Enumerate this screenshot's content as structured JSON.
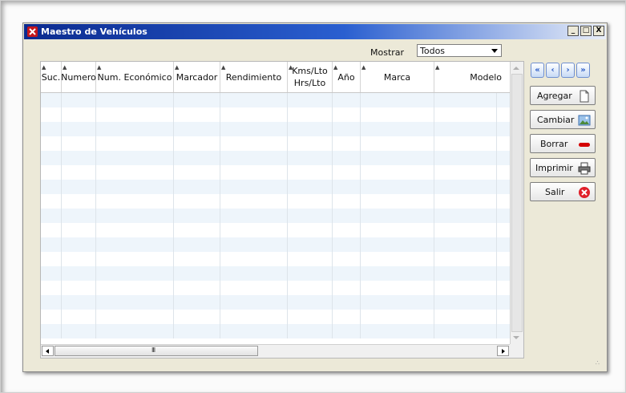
{
  "window": {
    "title": "Maestro de Vehículos",
    "controls": {
      "minimize": "_",
      "maximize": "□",
      "close": "X"
    }
  },
  "filter": {
    "label": "Mostrar",
    "selected": "Todos"
  },
  "table": {
    "columns": [
      "Suc.",
      "Numero",
      "Num. Económico",
      "Marcador",
      "Rendimiento",
      "Kms/Lto\nHrs/Lto",
      "Año",
      "Marca",
      "Modelo"
    ],
    "rows": []
  },
  "scrollbar": {
    "grip": "III"
  },
  "navigation": {
    "first": "«",
    "prev": "‹",
    "next": "›",
    "last": "»"
  },
  "actions": {
    "add": "Agregar",
    "edit": "Cambiar",
    "delete": "Borrar",
    "print": "Imprimir",
    "exit": "Salir"
  },
  "colors": {
    "title_gradient_start": "#0b2a8f",
    "row_stripe": "#eef5fb",
    "delete_icon": "#d40000",
    "exit_icon": "#e0202a"
  }
}
